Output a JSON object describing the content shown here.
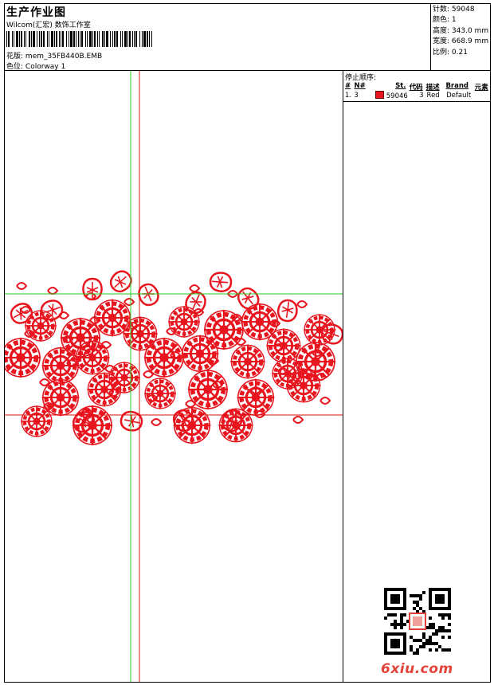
{
  "header": {
    "title": "生产作业图",
    "subtitle": "Wilcom(汇宏) 数饰工作室",
    "design_label": "花版:",
    "design_value": "mem_35FB440B.EMB",
    "color_label": "色位:",
    "color_value": "Colorway 1"
  },
  "stats": [
    {
      "label": "针数:",
      "value": "59048"
    },
    {
      "label": "颜色:",
      "value": "1"
    },
    {
      "label": "高度:",
      "value": "343.0 mm"
    },
    {
      "label": "宽度:",
      "value": "668.9 mm"
    },
    {
      "label": "比例:",
      "value": "0.21"
    }
  ],
  "stop_panel": {
    "title": "停止顺序:",
    "columns": [
      "#",
      "N#",
      "St.",
      "代码",
      "描述",
      "Brand",
      "元素"
    ],
    "rows": [
      {
        "idx": "1.",
        "n": "3",
        "stitches": "59046",
        "code": "3",
        "desc": "Red",
        "brand": "Default",
        "elem": "",
        "color": "#e8141e"
      }
    ]
  },
  "watermark": {
    "text": "6xiu.com",
    "color": "#e2433a"
  },
  "colors": {
    "thread": "#e8141e",
    "guide_green": "#22cc22",
    "guide_red": "#e01010"
  }
}
